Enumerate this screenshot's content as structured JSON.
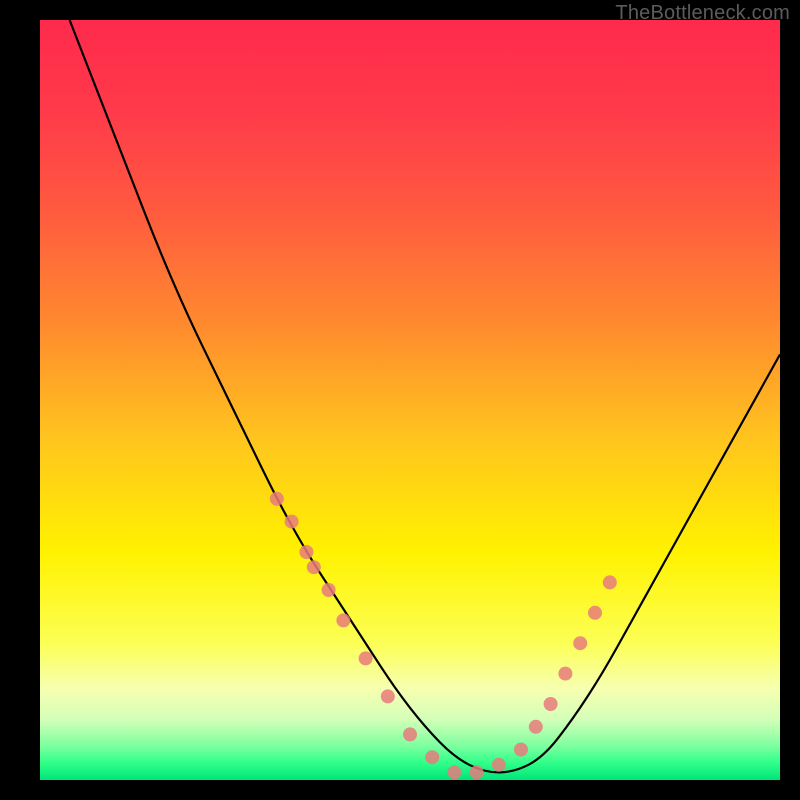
{
  "watermark": "TheBottleneck.com",
  "gradient": {
    "stops": [
      {
        "offset": 0.0,
        "color": "#ff2a4c"
      },
      {
        "offset": 0.12,
        "color": "#ff3a4a"
      },
      {
        "offset": 0.25,
        "color": "#ff5a3f"
      },
      {
        "offset": 0.4,
        "color": "#ff8a2e"
      },
      {
        "offset": 0.55,
        "color": "#ffc41e"
      },
      {
        "offset": 0.7,
        "color": "#fff200"
      },
      {
        "offset": 0.82,
        "color": "#fcff55"
      },
      {
        "offset": 0.88,
        "color": "#f6ffb0"
      },
      {
        "offset": 0.92,
        "color": "#d4ffb8"
      },
      {
        "offset": 0.955,
        "color": "#7dffa0"
      },
      {
        "offset": 0.978,
        "color": "#2eff89"
      },
      {
        "offset": 1.0,
        "color": "#00e47a"
      }
    ]
  },
  "chart_data": {
    "type": "line",
    "title": "",
    "xlabel": "",
    "ylabel": "",
    "xlim": [
      0,
      100
    ],
    "ylim": [
      0,
      100
    ],
    "series": [
      {
        "name": "bottleneck-curve",
        "x": [
          4,
          8,
          12,
          16,
          20,
          24,
          28,
          32,
          36,
          40,
          44,
          48,
          52,
          56,
          60,
          64,
          68,
          72,
          76,
          80,
          84,
          88,
          92,
          96,
          100
        ],
        "y": [
          100,
          90,
          80,
          70,
          61,
          53,
          45,
          37,
          30,
          24,
          18,
          12,
          7,
          3,
          1,
          1,
          3,
          8,
          14,
          21,
          28,
          35,
          42,
          49,
          56
        ]
      }
    ],
    "markers": {
      "name": "highlight-dots",
      "x": [
        32,
        34,
        36,
        37,
        39,
        41,
        44,
        47,
        50,
        53,
        56,
        59,
        62,
        65,
        67,
        69,
        71,
        73,
        75,
        77
      ],
      "y": [
        37,
        34,
        30,
        28,
        25,
        21,
        16,
        11,
        6,
        3,
        1,
        1,
        2,
        4,
        7,
        10,
        14,
        18,
        22,
        26
      ]
    }
  },
  "curve_color": "#000000",
  "marker_color": "#e77b7b"
}
